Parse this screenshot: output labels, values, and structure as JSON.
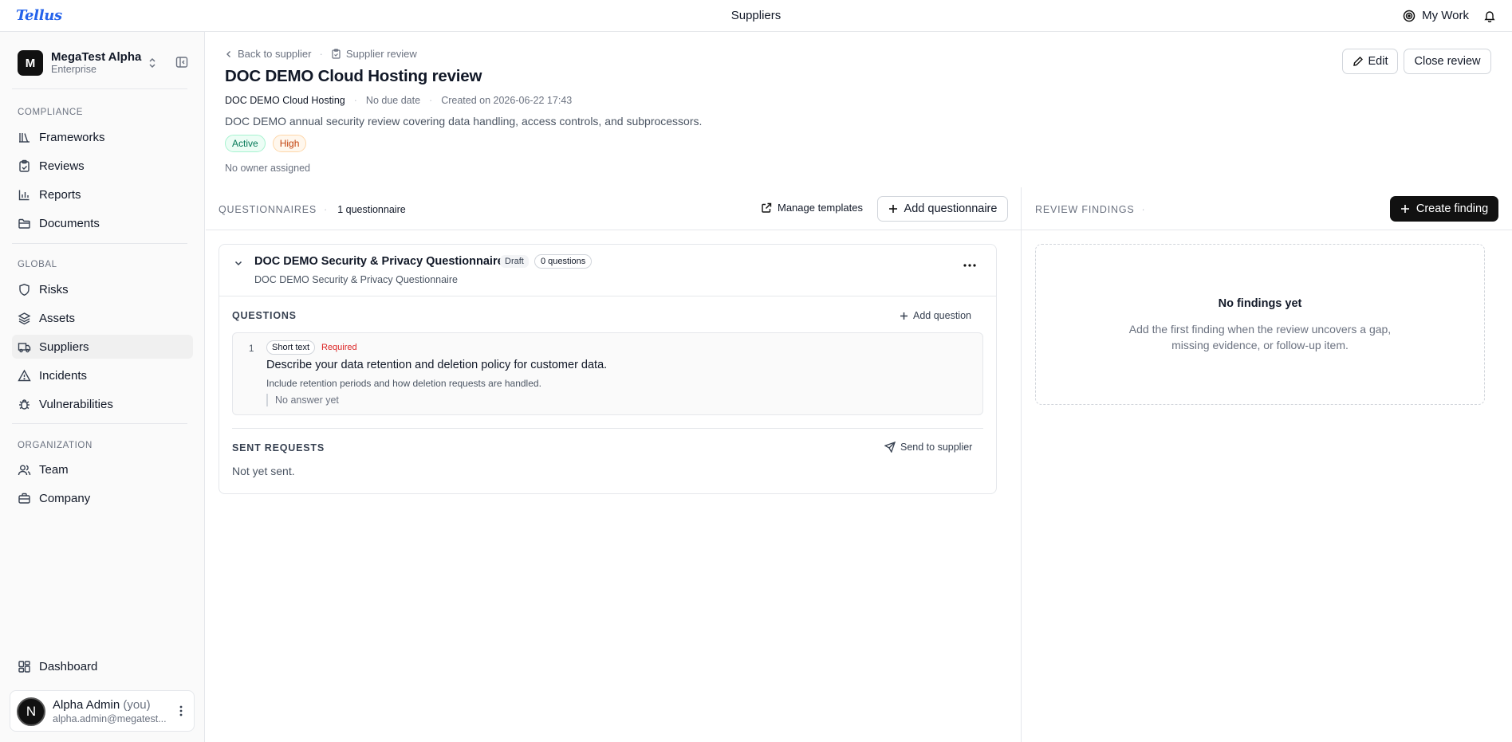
{
  "app": {
    "logo": "Tellus",
    "page_title": "Suppliers",
    "my_work": "My Work"
  },
  "sidebar": {
    "workspace": {
      "initial": "M",
      "name": "MegaTest Alpha",
      "plan": "Enterprise"
    },
    "sections": {
      "compliance": "COMPLIANCE",
      "global": "GLOBAL",
      "organization": "ORGANIZATION"
    },
    "compliance_items": [
      {
        "label": "Frameworks",
        "icon": "frameworks-icon"
      },
      {
        "label": "Reviews",
        "icon": "clipboard-check-icon"
      },
      {
        "label": "Reports",
        "icon": "bar-chart-icon"
      },
      {
        "label": "Documents",
        "icon": "folder-icon"
      }
    ],
    "global_items": [
      {
        "label": "Risks",
        "icon": "shield-icon"
      },
      {
        "label": "Assets",
        "icon": "layers-icon"
      },
      {
        "label": "Suppliers",
        "icon": "truck-icon"
      },
      {
        "label": "Incidents",
        "icon": "alert-triangle-icon"
      },
      {
        "label": "Vulnerabilities",
        "icon": "bug-icon"
      }
    ],
    "organization_items": [
      {
        "label": "Team",
        "icon": "users-icon"
      },
      {
        "label": "Company",
        "icon": "building-icon"
      }
    ],
    "dashboard": "Dashboard",
    "user": {
      "avatar_initial": "N",
      "name": "Alpha Admin",
      "you": "(you)",
      "email": "alpha.admin@megatest..."
    }
  },
  "review": {
    "back_link": "Back to supplier",
    "type_crumb": "Supplier review",
    "title": "DOC DEMO Cloud Hosting review",
    "supplier": "DOC DEMO Cloud Hosting",
    "due": "No due date",
    "created": "Created on 2026-06-22 17:43",
    "description": "DOC DEMO annual security review covering data handling, access controls, and subprocessors.",
    "status_badge": "Active",
    "severity_badge": "High",
    "owner": "No owner assigned",
    "edit_label": "Edit",
    "close_label": "Close review"
  },
  "questionnaires": {
    "section_label": "QUESTIONNAIRES",
    "count": "1 questionnaire",
    "manage_templates": "Manage templates",
    "add_questionnaire": "Add questionnaire",
    "items": [
      {
        "title": "DOC DEMO Security & Privacy Questionnaire",
        "status": "Draft",
        "question_count": "0 questions",
        "subtitle": "DOC DEMO Security & Privacy Questionnaire",
        "questions_label": "QUESTIONS",
        "add_question": "Add question",
        "questions": [
          {
            "number": "1",
            "type": "Short text",
            "required": "Required",
            "text": "Describe your data retention and deletion policy for customer data.",
            "help": "Include retention periods and how deletion requests are handled.",
            "answer": "No answer yet"
          }
        ],
        "sent_requests_label": "SENT REQUESTS",
        "send_to_supplier": "Send to supplier",
        "sent_status": "Not yet sent."
      }
    ]
  },
  "findings": {
    "section_label": "REVIEW FINDINGS",
    "create_label": "Create finding",
    "empty_title": "No findings yet",
    "empty_text": "Add the first finding when the review uncovers a gap, missing evidence, or follow-up item."
  }
}
